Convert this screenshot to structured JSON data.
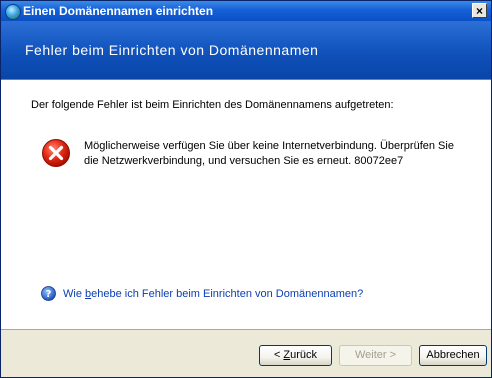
{
  "window": {
    "title": "Einen Domänennamen einrichten",
    "close_glyph": "×"
  },
  "banner": {
    "title": "Fehler beim Einrichten von Domänennamen"
  },
  "content": {
    "intro": "Der folgende Fehler ist beim Einrichten des Domänennamens aufgetreten:",
    "error_message": "Möglicherweise verfügen Sie über keine Internetverbindung. Überprüfen Sie die Netzwerkverbindung, und versuchen Sie es erneut. 80072ee7",
    "help_link_prefix": "Wie ",
    "help_link_accel": "b",
    "help_link_rest": "ehebe ich Fehler beim Einrichten von Domänennamen?"
  },
  "buttons": {
    "back_prefix": "< ",
    "back_accel": "Z",
    "back_rest": "urück",
    "next": "Weiter >",
    "cancel": "Abbrechen"
  },
  "icons": {
    "title": "globe-icon",
    "error": "error-icon",
    "help": "help-icon"
  },
  "colors": {
    "banner": "#0e4fb8",
    "link": "#0b3fb0",
    "error_red": "#d81e05",
    "dialog_bg": "#ece9d8"
  }
}
